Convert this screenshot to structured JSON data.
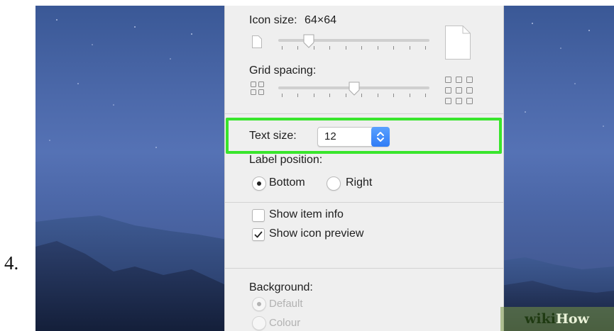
{
  "step": {
    "number": "4."
  },
  "panel": {
    "icon_size": {
      "label": "Icon size:",
      "value": "64×64",
      "slider_level": 0.2
    },
    "grid_spacing": {
      "label": "Grid spacing:",
      "slider_level": 0.5
    },
    "text_size": {
      "label": "Text size:",
      "value": "12"
    },
    "label_position": {
      "label": "Label position:",
      "options": [
        {
          "label": "Bottom",
          "selected": true
        },
        {
          "label": "Right",
          "selected": false
        }
      ]
    },
    "show_item_info": {
      "label": "Show item info",
      "checked": false
    },
    "show_icon_preview": {
      "label": "Show icon preview",
      "checked": true
    },
    "background": {
      "label": "Background:",
      "options": [
        {
          "label": "Default",
          "selected": true,
          "disabled": true
        },
        {
          "label": "Colour",
          "selected": false,
          "disabled": true
        }
      ]
    }
  },
  "highlight_color": "#39e52c",
  "watermark": {
    "wiki": "wiki",
    "how": "How"
  }
}
